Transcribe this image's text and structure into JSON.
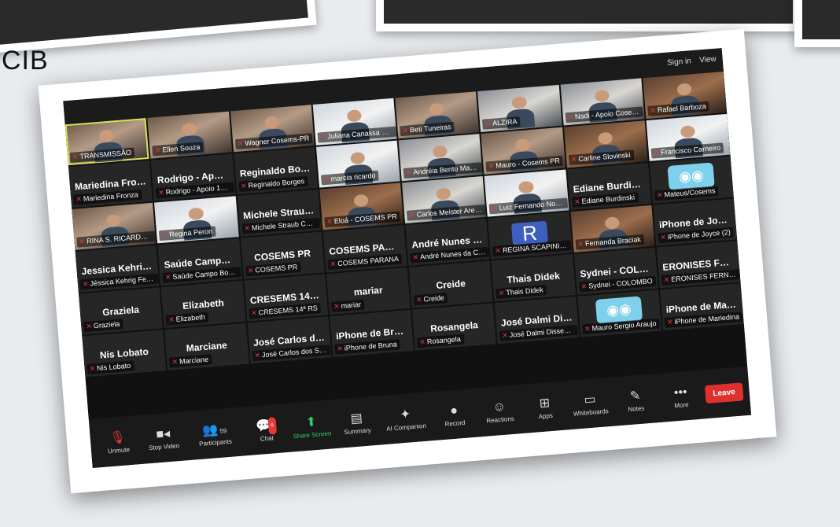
{
  "background": {
    "partial_text": "CIB"
  },
  "window": {
    "sign_in": "Sign in",
    "view": "View"
  },
  "tiles": [
    {
      "label": "TRANSMISSÃO",
      "kind": "video",
      "active": true
    },
    {
      "label": "Ellen Souza",
      "kind": "video"
    },
    {
      "label": "Wagner Cosems-PR",
      "kind": "video"
    },
    {
      "label": "Juliana Canassa Cam...",
      "kind": "video3"
    },
    {
      "label": "Beti Tuneiras",
      "kind": "video"
    },
    {
      "label": "ALZIRA",
      "kind": "video1"
    },
    {
      "label": "Nadi - Apoio Cosems",
      "kind": "video1"
    },
    {
      "label": "Rafael Barboza",
      "kind": "video2"
    },
    {
      "name": "Mariedina Fronza",
      "label": "Mariedina Fronza",
      "kind": "name"
    },
    {
      "name": "Rodrigo - Apoio...",
      "label": "Rodrigo - Apoio 17ª ...",
      "kind": "name"
    },
    {
      "name": "Reginaldo Borges",
      "label": "Reginaldo Borges",
      "kind": "name"
    },
    {
      "label": "marcia ricardo",
      "kind": "video3"
    },
    {
      "label": "Andréia Bento Maria ...",
      "kind": "video1"
    },
    {
      "label": "Mauro - Cosems PR",
      "kind": "video"
    },
    {
      "label": "Carline Slovinski",
      "kind": "video2"
    },
    {
      "label": "Francisco Carneiro",
      "kind": "video3"
    },
    {
      "label": "RINA S. RICARDO...",
      "kind": "video"
    },
    {
      "label": "Regina Peron",
      "kind": "video3"
    },
    {
      "name": "Michele Straub...",
      "label": "Michele Straub COSE...",
      "kind": "name"
    },
    {
      "label": "Eloá - COSEMS PR",
      "kind": "video2"
    },
    {
      "label": "Carlos Meister Arenh...",
      "kind": "video1"
    },
    {
      "label": "Luiz Fernando Novais",
      "kind": "video3"
    },
    {
      "name": "Ediane Burdinski",
      "label": "Ediane Burdinski",
      "kind": "name"
    },
    {
      "label": "Mateus/Cosems",
      "kind": "logo"
    },
    {
      "name": "Jessica Kehrig F...",
      "label": "Jéssica Kehrig Fernan...",
      "kind": "name"
    },
    {
      "name": "Saúde Campo B...",
      "label": "Saúde Campo Bonito",
      "kind": "name"
    },
    {
      "name": "COSEMS PR",
      "label": "COSEMS PR",
      "kind": "name"
    },
    {
      "name": "COSEMS PARANA",
      "label": "COSEMS PARANA",
      "kind": "name"
    },
    {
      "name": "André Nunes da...",
      "label": "André Nunes da Cost...",
      "kind": "name"
    },
    {
      "label": "REGINA SCAPINI, secr...",
      "kind": "avatar",
      "initial": "R"
    },
    {
      "label": "Fernanda Braciak",
      "kind": "video2"
    },
    {
      "name": "iPhone de Joyce...",
      "label": "iPhone de Joyce (2)",
      "kind": "name"
    },
    {
      "name": "Graziela",
      "label": "Graziela",
      "kind": "name"
    },
    {
      "name": "Elizabeth",
      "label": "Elizabeth",
      "kind": "name"
    },
    {
      "name": "CRESEMS 14ª RS",
      "label": "CRESEMS 14ª RS",
      "kind": "name"
    },
    {
      "name": "mariar",
      "label": "mariar",
      "kind": "name"
    },
    {
      "name": "Creide",
      "label": "Creide",
      "kind": "name"
    },
    {
      "name": "Thais Didek",
      "label": "Thais Didek",
      "kind": "name"
    },
    {
      "name": "Sydnei - COLOM...",
      "label": "Sydnei - COLOMBO",
      "kind": "name"
    },
    {
      "name": "ERONISES FERN...",
      "label": "ERONISES FERNAND...",
      "kind": "name"
    },
    {
      "name": "Nis Lobato",
      "label": "Nis Lobato",
      "kind": "name"
    },
    {
      "name": "Marciane",
      "label": "Marciane",
      "kind": "name"
    },
    {
      "name": "José Carlos dos...",
      "label": "José Carlos dos Sant...",
      "kind": "name"
    },
    {
      "name": "iPhone de Bruna",
      "label": "iPhone de Bruna",
      "kind": "name"
    },
    {
      "name": "Rosangela",
      "label": "Rosangela",
      "kind": "name"
    },
    {
      "name": "José Dalmi Diss...",
      "label": "José Dalmi Dissenha ...",
      "kind": "name"
    },
    {
      "label": "Mauro Sergio Araujo",
      "kind": "logo"
    },
    {
      "name": "iPhone de Marie...",
      "label": "iPhone de Mariedina",
      "kind": "name"
    }
  ],
  "toolbar": {
    "unmute": "Unmute",
    "stop_video": "Stop Video",
    "participants": "Participants",
    "participants_count": "59",
    "chat": "Chat",
    "chat_badge": "6",
    "share_screen": "Share Screen",
    "summary": "Summary",
    "ai_companion": "AI Companion",
    "record": "Record",
    "reactions": "Reactions",
    "apps": "Apps",
    "whiteboards": "Whiteboards",
    "notes": "Notes",
    "more": "More",
    "leave": "Leave"
  }
}
